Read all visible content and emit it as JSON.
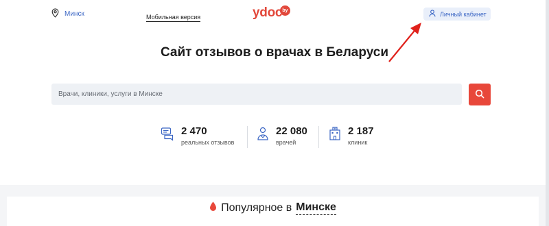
{
  "header": {
    "city": "Минск",
    "mobile_link": "Мобильная версия",
    "logo_text": "ydoc",
    "logo_badge": "by",
    "account_label": "Личный кабинет"
  },
  "hero": {
    "title": "Сайт отзывов о врачах в Беларуси"
  },
  "search": {
    "placeholder": "Врачи, клиники, услуги в Минске"
  },
  "stats": [
    {
      "value": "2 470",
      "label": "реальных отзывов",
      "icon": "reviews-icon"
    },
    {
      "value": "22 080",
      "label": "врачей",
      "icon": "doctor-icon"
    },
    {
      "value": "2 187",
      "label": "клиник",
      "icon": "clinic-icon"
    }
  ],
  "popular": {
    "prefix": "Популярное в",
    "city": "Минске"
  },
  "colors": {
    "accent": "#e8473a",
    "link": "#3b66c4",
    "annotation_arrow": "#e0211b"
  }
}
